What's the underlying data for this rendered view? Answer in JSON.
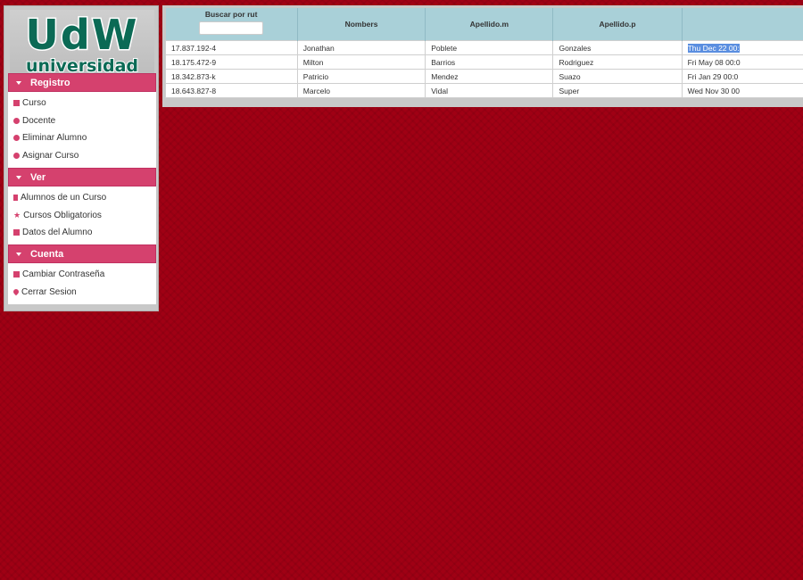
{
  "logo": {
    "big": "UdW",
    "small": "universidad"
  },
  "sidebar": {
    "registro": {
      "title": "Registro",
      "items": [
        "Curso",
        "Docente",
        "Eliminar Alumno",
        "Asignar Curso"
      ]
    },
    "ver": {
      "title": "Ver",
      "items": [
        "Alumnos de un Curso",
        "Cursos Obligatorios",
        "Datos del Alumno"
      ]
    },
    "cuenta": {
      "title": "Cuenta",
      "items": [
        "Cambiar Contraseña",
        "Cerrar Sesion"
      ]
    }
  },
  "table": {
    "search_label": "Buscar por rut",
    "headers": [
      "Nombers",
      "Apellido.m",
      "Apellido.p"
    ],
    "rows": [
      [
        "17.837.192-4",
        "Jonathan",
        "Poblete",
        "Gonzales",
        "Thu Dec 22 00:"
      ],
      [
        "18.175.472-9",
        "Milton",
        "Barrios",
        "Rodriguez",
        "Fri May 08 00:0"
      ],
      [
        "18.342.873-k",
        "Patricio",
        "Mendez",
        "Suazo",
        "Fri Jan 29 00:0"
      ],
      [
        "18.643.827-8",
        "Marcelo",
        "Vidal",
        "Super",
        "Wed Nov 30 00"
      ]
    ]
  },
  "colors": {
    "accent": "#d5416e",
    "header": "#a9d0d8",
    "background": "#a00014"
  }
}
